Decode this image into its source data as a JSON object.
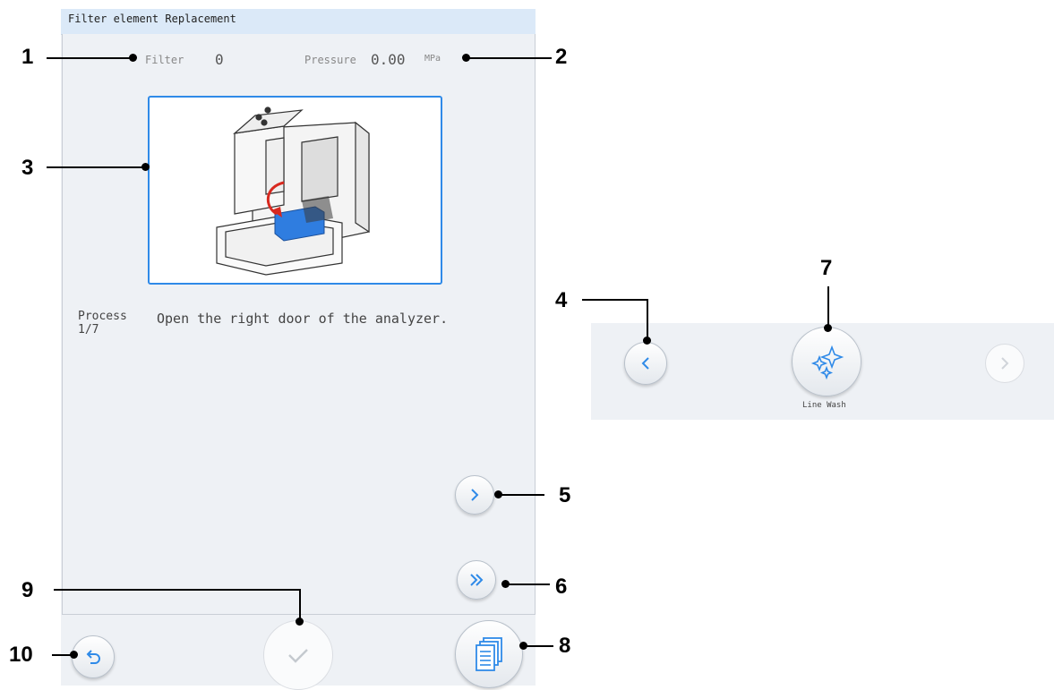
{
  "window": {
    "title": "Filter element Replacement"
  },
  "status": {
    "filter_label": "Filter",
    "filter_value": "0",
    "pressure_label": "Pressure",
    "pressure_value": "0.00",
    "pressure_unit": "MPa"
  },
  "process": {
    "label": "Process",
    "step": "1/7",
    "instruction": "Open the right door of the analyzer."
  },
  "snippet": {
    "line_wash_label": "Line Wash"
  },
  "callouts": [
    "1",
    "2",
    "3",
    "4",
    "5",
    "6",
    "7",
    "8",
    "9",
    "10"
  ],
  "colors": {
    "accent": "#2f8ae8",
    "title_bar": "#dbe9f8",
    "panel": "#eef1f5"
  },
  "icons": {
    "prev": "chevron-left-icon",
    "next": "chevron-right-icon",
    "skip": "double-chevron-right-icon",
    "ok": "checkmark-icon",
    "manual": "document-stack-icon",
    "back": "undo-arrow-icon",
    "line_wash": "sparkle-icon"
  }
}
